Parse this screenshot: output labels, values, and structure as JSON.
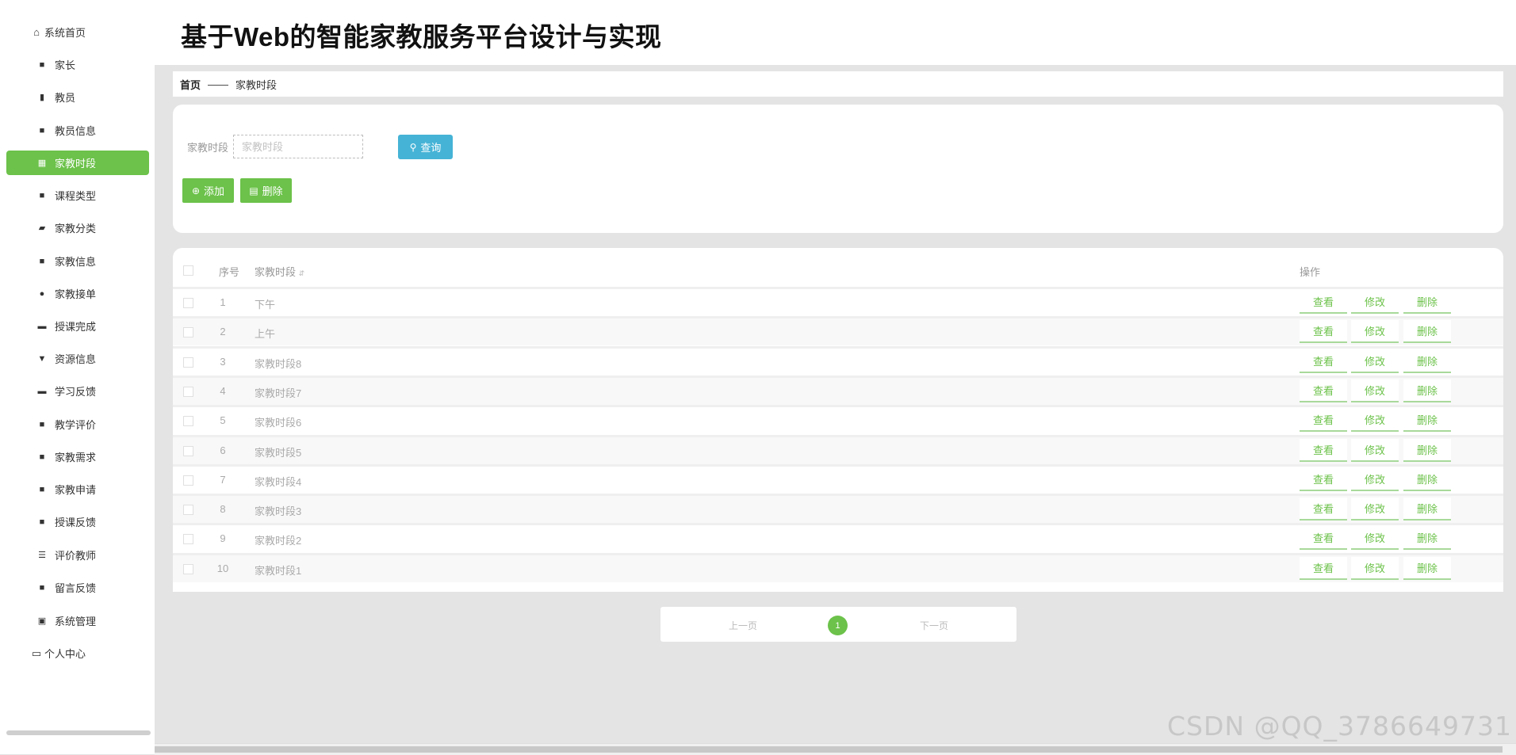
{
  "app": {
    "title": "基于Web的智能家教服务平台设计与实现"
  },
  "sidebar": {
    "items": [
      {
        "label": "系统首页",
        "icon": "home-icon",
        "glyph": "⌂"
      },
      {
        "label": "家长",
        "icon": "grid-icon",
        "glyph": "■"
      },
      {
        "label": "教员",
        "icon": "bar-chart-icon",
        "glyph": "▮"
      },
      {
        "label": "教员信息",
        "icon": "grid-icon",
        "glyph": "■"
      },
      {
        "label": "家教时段",
        "icon": "grid-icon",
        "glyph": "▦"
      },
      {
        "label": "课程类型",
        "icon": "grid-icon",
        "glyph": "■"
      },
      {
        "label": "家教分类",
        "icon": "wallet-icon",
        "glyph": "▰"
      },
      {
        "label": "家教信息",
        "icon": "grid-icon",
        "glyph": "■"
      },
      {
        "label": "家教接单",
        "icon": "user-icon",
        "glyph": "●"
      },
      {
        "label": "授课完成",
        "icon": "monitor-icon",
        "glyph": "▬"
      },
      {
        "label": "资源信息",
        "icon": "pin-icon",
        "glyph": "▼"
      },
      {
        "label": "学习反馈",
        "icon": "book-icon",
        "glyph": "▬"
      },
      {
        "label": "教学评价",
        "icon": "grid-icon",
        "glyph": "■"
      },
      {
        "label": "家教需求",
        "icon": "grid-icon",
        "glyph": "■"
      },
      {
        "label": "家教申请",
        "icon": "grid-icon",
        "glyph": "■"
      },
      {
        "label": "授课反馈",
        "icon": "grid-icon",
        "glyph": "■"
      },
      {
        "label": "评价教师",
        "icon": "sliders-icon",
        "glyph": "☰"
      },
      {
        "label": "留言反馈",
        "icon": "grid-icon",
        "glyph": "■"
      },
      {
        "label": "系统管理",
        "icon": "clipboard-icon",
        "glyph": "▣"
      },
      {
        "label": "个人中心",
        "icon": "card-icon",
        "glyph": "▭"
      }
    ],
    "active_index": 4
  },
  "breadcrumb": {
    "home": "首页",
    "separator": "——",
    "current": "家教时段"
  },
  "search": {
    "label": "家教时段",
    "placeholder": "家教时段",
    "value": "",
    "query_label": "查询"
  },
  "toolbar": {
    "add_label": "添加",
    "delete_label": "删除"
  },
  "table": {
    "headers": {
      "index": "序号",
      "period": "家教时段",
      "actions": "操作"
    },
    "rows": [
      {
        "index": "1",
        "period": "下午"
      },
      {
        "index": "2",
        "period": "上午"
      },
      {
        "index": "3",
        "period": "家教时段8"
      },
      {
        "index": "4",
        "period": "家教时段7"
      },
      {
        "index": "5",
        "period": "家教时段6"
      },
      {
        "index": "6",
        "period": "家教时段5"
      },
      {
        "index": "7",
        "period": "家教时段4"
      },
      {
        "index": "8",
        "period": "家教时段3"
      },
      {
        "index": "9",
        "period": "家教时段2"
      },
      {
        "index": "10",
        "period": "家教时段1"
      }
    ],
    "row_actions": {
      "view": "查看",
      "edit": "修改",
      "delete": "删除"
    }
  },
  "pagination": {
    "prev": "上一页",
    "current": "1",
    "next": "下一页"
  },
  "watermark": "CSDN @QQ_3786649731",
  "colors": {
    "accent": "#6cc24a",
    "query": "#45b3d6"
  }
}
